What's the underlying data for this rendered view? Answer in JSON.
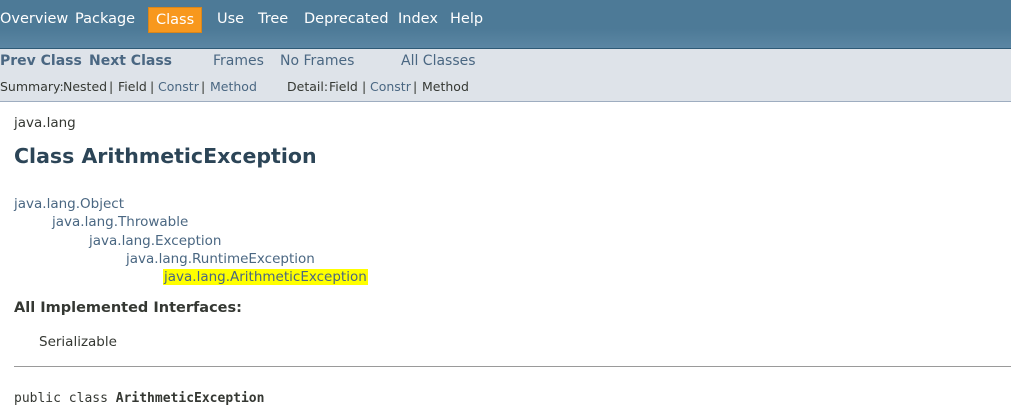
{
  "top_nav": {
    "items": [
      "Overview",
      "Package",
      "Class",
      "Use",
      "Tree",
      "Deprecated",
      "Index",
      "Help"
    ],
    "active": "Class"
  },
  "sub_nav": {
    "prev_class": "Prev Class",
    "next_class": "Next Class",
    "frames": "Frames",
    "no_frames": "No Frames",
    "all_classes": "All Classes",
    "summary_label": "Summary:",
    "summary_items": [
      "Nested",
      "Field",
      "Constr",
      "Method"
    ],
    "detail_label": "Detail:",
    "detail_items": [
      "Field",
      "Constr",
      "Method"
    ],
    "separator": "|"
  },
  "content": {
    "package": "java.lang",
    "class_title": "Class ArithmeticException",
    "inheritance": [
      "java.lang.Object",
      "java.lang.Throwable",
      "java.lang.Exception",
      "java.lang.RuntimeException",
      "java.lang.ArithmeticException"
    ],
    "all_implemented_interfaces_label": "All Implemented Interfaces:",
    "interfaces": [
      "Serializable"
    ],
    "declaration_prefix": "public class",
    "declaration_name": "ArithmeticException"
  },
  "colors": {
    "top_nav_bg": "#4d7a97",
    "active_tab": "#f8981d",
    "sub_nav_bg": "#dee3e9",
    "link": "#4a6782",
    "highlight": "#ffff00"
  }
}
